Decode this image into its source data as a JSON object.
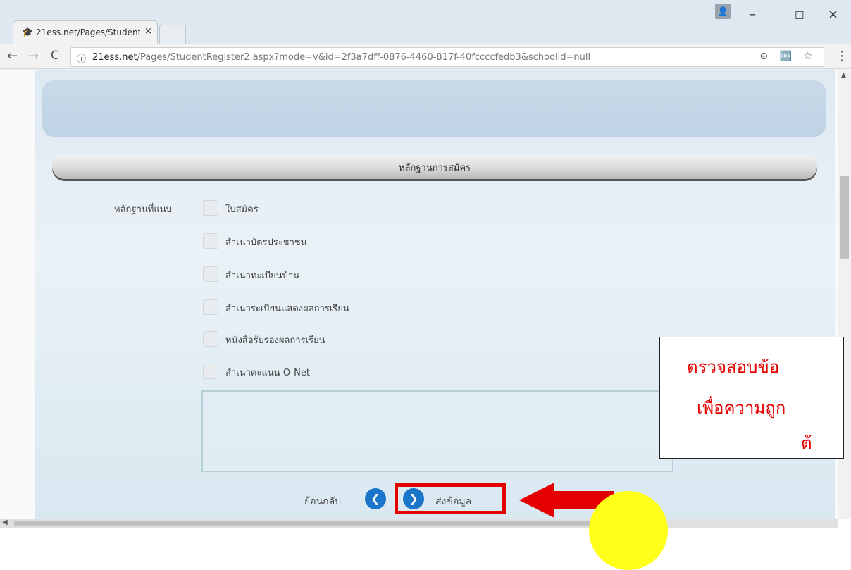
{
  "browser": {
    "tab_title": "21ess.net/Pages/Student",
    "tab_close": "×",
    "url_domain": "21ess.net",
    "url_path": "/Pages/StudentRegister2.aspx?mode=v&id=2f3a7dff-0876-4460-817f-40fccccfedb3&schoolid=null",
    "back": "←",
    "forward": "→",
    "reload": "C",
    "info": "ⓘ",
    "tools": "⊕ 🔤 ☆",
    "menu": "⋮",
    "minimize": "–",
    "maximize": "☐",
    "close": "×"
  },
  "page": {
    "section_title": "หลักฐานการสมัคร",
    "field_label": "หลักฐานที่แนบ",
    "documents": [
      {
        "label": "ใบสมัคร"
      },
      {
        "label": "สำเนาบัตรประชาชน"
      },
      {
        "label": "สำเนาทะเบียนบ้าน"
      },
      {
        "label": "สำเนาระเบียนแสดงผลการเรียน"
      },
      {
        "label": "หนังสือรับรองผลการเรียน"
      },
      {
        "label": "สำเนาคะแนน O-Net"
      }
    ],
    "back_label": "ย้อนกลับ",
    "send_label": "ส่งข้อมูล"
  },
  "annotation": {
    "line1": "ตรวจสอบข้อ",
    "line2": "เพื่อความถูก",
    "line3": "ต้",
    "color": "#e60000"
  }
}
